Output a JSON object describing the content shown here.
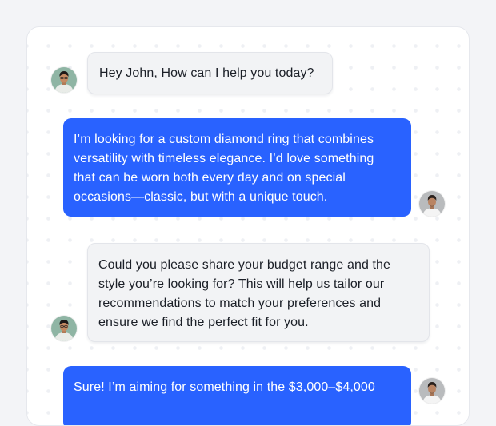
{
  "conversation": {
    "messages": [
      {
        "sender": "agent",
        "lines": [
          "Hey John, How can I help you today?"
        ]
      },
      {
        "sender": "user",
        "lines": [
          "I’m looking for a custom diamond ring that combines",
          "versatility with timeless elegance. I’d love something",
          "that can be worn both every day and on special",
          "occasions—classic, but with a unique touch."
        ]
      },
      {
        "sender": "agent",
        "lines": [
          "Could you please share your budget range and the",
          "style you’re looking for? This will help us tailor our",
          "recommendations to match your preferences and",
          "ensure we find the perfect fit for you."
        ]
      },
      {
        "sender": "user",
        "lines": [
          "Sure! I’m aiming for something in the $3,000–$4,000"
        ]
      }
    ]
  },
  "colors": {
    "user_bubble": "#2962ff",
    "agent_bubble": "#f2f3f5",
    "card_background": "#ffffff",
    "page_background": "#f3f4f7"
  },
  "icons": {
    "agent_avatar": "agent-avatar",
    "user_avatar": "user-avatar"
  }
}
